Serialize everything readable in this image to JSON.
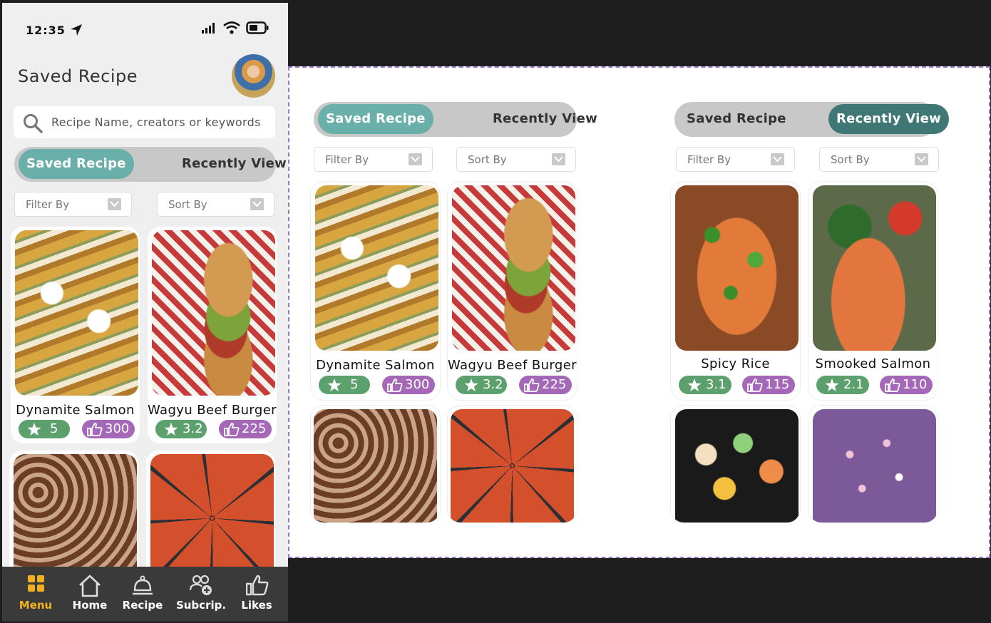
{
  "status_bar": {
    "time": "12:35"
  },
  "phone": {
    "title": "Saved Recipe",
    "search_placeholder": "Recipe Name, creators or keywords"
  },
  "segment": {
    "saved": "Saved Recipe",
    "recent": "Recently View"
  },
  "filters": {
    "filter_by": "Filter By",
    "sort_by": "Sort By"
  },
  "saved_recipes": [
    {
      "name": "Dynamite Salmon",
      "rating": "5",
      "likes": "300",
      "image": "sushi"
    },
    {
      "name": "Wagyu Beef Burger",
      "rating": "3.2",
      "likes": "225",
      "image": "burger"
    },
    {
      "name": "",
      "rating": "",
      "likes": "",
      "image": "churros"
    },
    {
      "name": "",
      "rating": "",
      "likes": "",
      "image": "pizza"
    }
  ],
  "recent_recipes": [
    {
      "name": "Spicy Rice",
      "rating": "3.1",
      "likes": "115",
      "image": "spicy-rice"
    },
    {
      "name": "Smooked Salmon",
      "rating": "2.1",
      "likes": "110",
      "image": "salmon"
    },
    {
      "name": "",
      "rating": "",
      "likes": "",
      "image": "sushi-platter"
    },
    {
      "name": "",
      "rating": "",
      "likes": "",
      "image": "cupcakes"
    }
  ],
  "nav": {
    "items": [
      {
        "label": "Menu",
        "icon": "grid-icon",
        "active": true
      },
      {
        "label": "Home",
        "icon": "home-icon",
        "active": false
      },
      {
        "label": "Recipe",
        "icon": "cloche-icon",
        "active": false
      },
      {
        "label": "Subcrip.",
        "icon": "users-add-icon",
        "active": false
      },
      {
        "label": "Likes",
        "icon": "thumbs-up-icon",
        "active": false
      }
    ]
  },
  "colors": {
    "teal": "#6aafa9",
    "dark_teal": "#3f7775",
    "rating_green": "#5ba06d",
    "like_purple": "#a567b8",
    "nav_active": "#f0b020",
    "board_border": "#9a78c6"
  }
}
